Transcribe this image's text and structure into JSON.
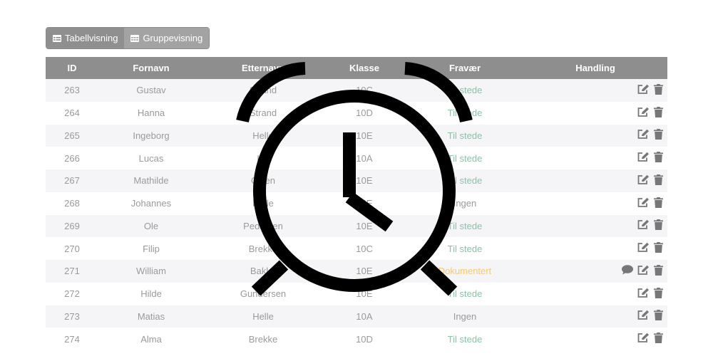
{
  "toolbar": {
    "table_view_label": "Tabellvisning",
    "group_view_label": "Gruppevisning",
    "table_view_icon": "table-list-icon",
    "group_view_icon": "grid-icon"
  },
  "table": {
    "headers": {
      "id": "ID",
      "first_name": "Fornavn",
      "last_name": "Etternavn",
      "class": "Klasse",
      "absence": "Fravær",
      "action": "Handling"
    },
    "rows": [
      {
        "id": "263",
        "first_name": "Gustav",
        "last_name": "Strand",
        "class": "10C",
        "absence": "Til stede",
        "status": "present",
        "comment": false
      },
      {
        "id": "264",
        "first_name": "Hanna",
        "last_name": "Strand",
        "class": "10D",
        "absence": "Til stede",
        "status": "present",
        "comment": false
      },
      {
        "id": "265",
        "first_name": "Ingeborg",
        "last_name": "Helle",
        "class": "10E",
        "absence": "Til stede",
        "status": "present",
        "comment": false
      },
      {
        "id": "266",
        "first_name": "Lucas",
        "last_name": "Lie",
        "class": "10A",
        "absence": "Til stede",
        "status": "present",
        "comment": false
      },
      {
        "id": "267",
        "first_name": "Mathilde",
        "last_name": "Olsen",
        "class": "10E",
        "absence": "Til stede",
        "status": "present",
        "comment": false
      },
      {
        "id": "268",
        "first_name": "Johannes",
        "last_name": "Helle",
        "class": "10E",
        "absence": "Ingen",
        "status": "none",
        "comment": false
      },
      {
        "id": "269",
        "first_name": "Ole",
        "last_name": "Pedersen",
        "class": "10E",
        "absence": "Til stede",
        "status": "present",
        "comment": false
      },
      {
        "id": "270",
        "first_name": "Filip",
        "last_name": "Brekke",
        "class": "10C",
        "absence": "Til stede",
        "status": "present",
        "comment": false
      },
      {
        "id": "271",
        "first_name": "William",
        "last_name": "Bakke",
        "class": "10E",
        "absence": "Dokumentert",
        "status": "doc",
        "comment": true
      },
      {
        "id": "272",
        "first_name": "Hilde",
        "last_name": "Gundersen",
        "class": "10E",
        "absence": "Til stede",
        "status": "present",
        "comment": false
      },
      {
        "id": "273",
        "first_name": "Matias",
        "last_name": "Helle",
        "class": "10A",
        "absence": "Ingen",
        "status": "none",
        "comment": false
      },
      {
        "id": "274",
        "first_name": "Alma",
        "last_name": "Brekke",
        "class": "10D",
        "absence": "Til stede",
        "status": "present",
        "comment": false
      }
    ]
  },
  "icons": {
    "edit": "edit-icon",
    "delete": "trash-icon",
    "comment": "comment-icon",
    "overlay": "alarm-clock-icon"
  },
  "colors": {
    "header_bg": "#8e8e8e",
    "present": "#8cc1a7",
    "documented": "#f2c97a",
    "text_muted": "#9a9a9a",
    "icon": "#777777"
  }
}
